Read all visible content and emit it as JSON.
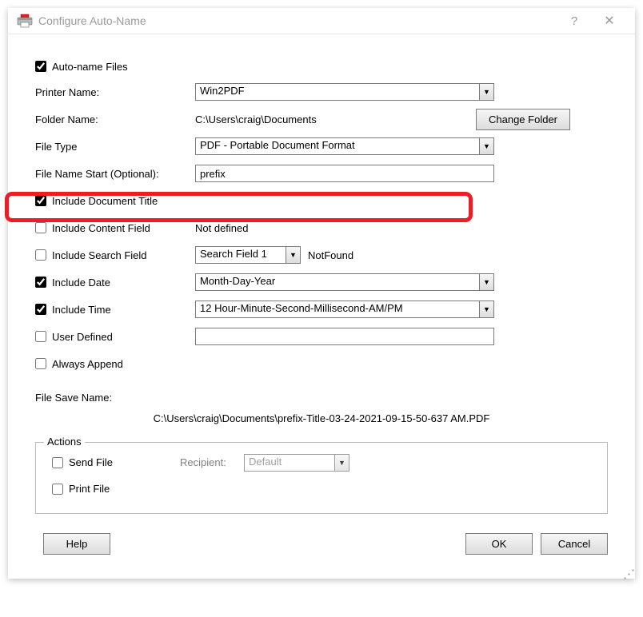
{
  "window": {
    "title": "Configure Auto-Name"
  },
  "autoname": {
    "label": "Auto-name Files",
    "checked": true
  },
  "printer": {
    "label": "Printer Name:",
    "value": "Win2PDF"
  },
  "folder": {
    "label": "Folder Name:",
    "value": "C:\\Users\\craig\\Documents",
    "button": "Change Folder"
  },
  "filetype": {
    "label": "File Type",
    "value": "PDF - Portable Document Format"
  },
  "fns": {
    "label": "File Name Start (Optional):",
    "value": "prefix"
  },
  "incTitle": {
    "label": "Include Document Title",
    "checked": true
  },
  "incContent": {
    "label": "Include Content Field",
    "checked": false,
    "value": "Not defined"
  },
  "incSearch": {
    "label": "Include Search Field",
    "checked": false,
    "dropdown": "Search Field 1",
    "status": "NotFound"
  },
  "incDate": {
    "label": "Include Date",
    "checked": true,
    "value": "Month-Day-Year"
  },
  "incTime": {
    "label": "Include Time",
    "checked": true,
    "value": "12 Hour-Minute-Second-Millisecond-AM/PM"
  },
  "userDef": {
    "label": "User Defined",
    "checked": false,
    "value": ""
  },
  "always": {
    "label": "Always Append",
    "checked": false
  },
  "fsn": {
    "label": "File Save Name:",
    "path": "C:\\Users\\craig\\Documents\\prefix-Title-03-24-2021-09-15-50-637 AM.PDF"
  },
  "actions": {
    "legend": "Actions",
    "send": {
      "label": "Send File",
      "checked": false
    },
    "recipient": {
      "label": "Recipient:",
      "value": "Default"
    },
    "print": {
      "label": "Print File",
      "checked": false
    }
  },
  "buttons": {
    "help": "Help",
    "ok": "OK",
    "cancel": "Cancel"
  }
}
